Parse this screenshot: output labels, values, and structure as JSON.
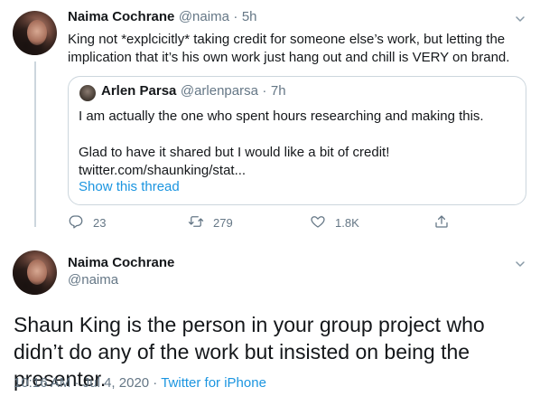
{
  "tweet1": {
    "name": "Naima Cochrane",
    "handle": "@naima",
    "separator": "·",
    "time": "5h",
    "text": "King not *explcicitly* taking credit for someone else’s work, but letting the implication that it’s his own work just hang out and chill is VERY on brand.",
    "quote": {
      "name": "Arlen Parsa",
      "handle": "@arlenparsa",
      "separator": "·",
      "time": "7h",
      "line1": "I am actually the one who spent hours researching and making this.",
      "line2": "Glad to have it shared but I would like a bit of credit!",
      "line3": "twitter.com/shaunking/stat...",
      "show_thread": "Show this thread"
    },
    "actions": {
      "reply_count": "23",
      "retweet_count": "279",
      "like_count": "1.8K"
    }
  },
  "tweet2": {
    "name": "Naima Cochrane",
    "handle": "@naima",
    "text": "Shaun King is the person in your group project who didn’t do any of the work but insisted on being the presenter.",
    "time": "10:16 AM",
    "separator": "·",
    "date": "Jul 4, 2020",
    "separator2": "·",
    "source": "Twitter for iPhone"
  },
  "colors": {
    "link": "#1b95e0",
    "muted": "#657786",
    "border": "#ccd6dd",
    "text": "#14171a"
  }
}
